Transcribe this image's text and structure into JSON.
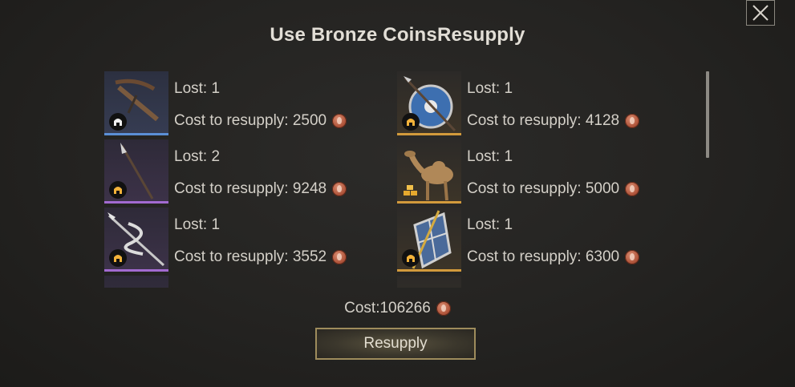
{
  "dialog": {
    "title": "Use Bronze CoinsResupply",
    "close_icon": "close-icon"
  },
  "items": [
    {
      "lost": "Lost: 1",
      "cost": "Cost to resupply: 2500",
      "rarity": "blue",
      "unit": "crossbow",
      "badge": "helmet-icon"
    },
    {
      "lost": "Lost: 1",
      "cost": "Cost to resupply: 4128",
      "rarity": "orange",
      "unit": "spear-shield",
      "badge": "helmet-icon"
    },
    {
      "lost": "Lost: 2",
      "cost": "Cost to resupply: 9248",
      "rarity": "purple",
      "unit": "spear",
      "badge": "helmet-icon"
    },
    {
      "lost": "Lost: 1",
      "cost": "Cost to resupply: 5000",
      "rarity": "orange",
      "unit": "camel",
      "badge": "gold-bars-icon"
    },
    {
      "lost": "Lost: 1",
      "cost": "Cost to resupply: 3552",
      "rarity": "purple",
      "unit": "serpent-spear",
      "badge": "helmet-icon"
    },
    {
      "lost": "Lost: 1",
      "cost": "Cost to resupply: 6300",
      "rarity": "orange",
      "unit": "tower-shield",
      "badge": "helmet-icon"
    }
  ],
  "footer": {
    "total_cost": "Cost:106266",
    "resupply_label": "Resupply",
    "currency_icon": "bronze-coin-icon"
  }
}
